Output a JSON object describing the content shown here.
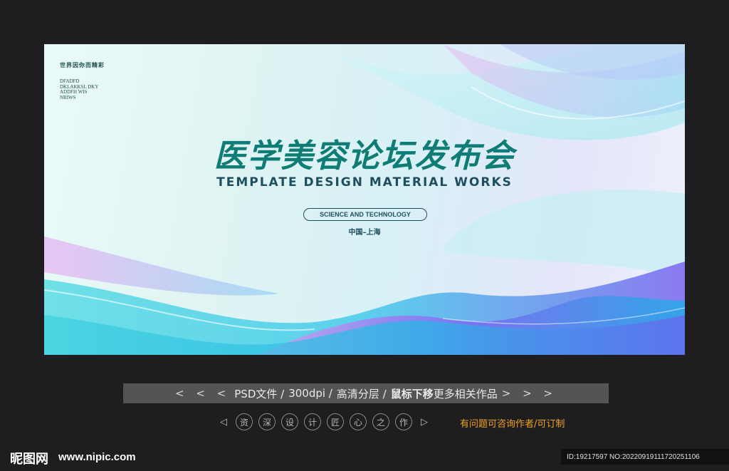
{
  "poster": {
    "brand_cn": "世界因你而精彩",
    "brand_lines": [
      "DFADFD",
      "DKLAKKSL DKY",
      "ADDFH WIS",
      "NRIWS"
    ],
    "title_cn": "医学美容论坛发布会",
    "title_en": "TEMPLATE DESIGN MATERIAL WORKS",
    "tagline": "SCIENCE AND TECHNOLOGY",
    "location": "中国–上海",
    "colors": {
      "title": "#0f7d75",
      "text_dark": "#1d4f5e"
    }
  },
  "info_bar": {
    "left_arrows": "< < <",
    "format": "PSD文件 /",
    "dpi": "300dpi /",
    "layers": "高清分层 /",
    "hover_hint": "鼠标下移",
    "more": "更多相关作品",
    "right_arrows": "> > >"
  },
  "nav": {
    "prev_icon": "◁",
    "next_icon": "▷",
    "chars": [
      "资",
      "深",
      "设",
      "计",
      "匠",
      "心",
      "之",
      "作"
    ],
    "contact": "有问题可咨询作者/可订制",
    "contact_color": "#f0a020"
  },
  "footer": {
    "logo": "昵图网",
    "url": "www.nipic.com",
    "id_text": "ID:19217597 NO:20220919111720251106"
  }
}
